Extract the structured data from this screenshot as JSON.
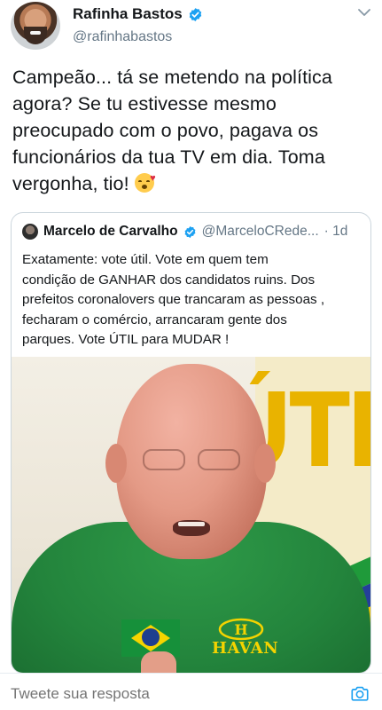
{
  "tweet": {
    "author_name": "Rafinha Bastos",
    "author_handle": "@rafinhabastos",
    "text_line1": "Campeão... tá se metendo na política",
    "text_line2": "agora? Se tu estivesse mesmo",
    "text_line3": "preocupado com o povo, pagava os",
    "text_line4": "funcionários da tua TV em dia. Toma",
    "text_line5": "vergonha, tio!",
    "emoji": "face-blowing-kiss-icon"
  },
  "quoted_tweet": {
    "author_name": "Marcelo de Carvalho",
    "author_handle": "@MarceloCRede...",
    "time": "· 1d",
    "text_line1": "Exatamente: vote útil. Vote em quem tem",
    "text_line2": "condição de GANHAR dos candidatos ruins. Dos",
    "text_line3": "prefeitos coronalovers que trancaram as pessoas ,",
    "text_line4": "fecharam o comércio, arrancaram gente dos",
    "text_line5": "parques. Vote ÚTIL para MUDAR !",
    "media": {
      "background_sign_text": "ÚTI",
      "shirt_logo_text": "HAVAN",
      "shirt_logo_initial": "H"
    }
  },
  "reply": {
    "placeholder": "Tweete sua resposta"
  },
  "icons": {
    "verified": "verified-badge-icon",
    "caret": "chevron-down-icon",
    "camera": "camera-icon"
  },
  "colors": {
    "verified_blue": "#1da1f2",
    "secondary_text": "#657786",
    "border": "#ccd6dd"
  }
}
